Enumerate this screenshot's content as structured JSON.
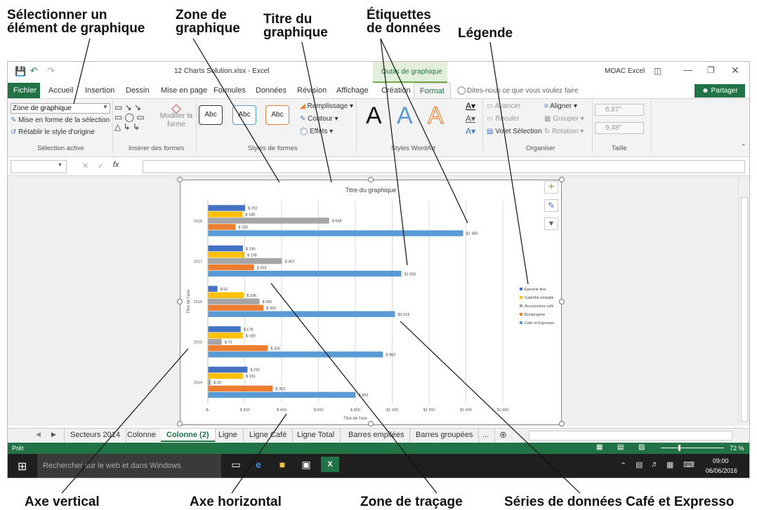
{
  "callouts": {
    "select_element": "Sélectionner un\nélément de graphique",
    "chart_area": "Zone de\ngraphique",
    "chart_title": "Titre du\ngraphique",
    "data_labels": "Étiquettes\nde données",
    "legend": "Légende",
    "vertical_axis": "Axe vertical",
    "horizontal_axis": "Axe horizontal",
    "plot_area": "Zone de traçage",
    "series": "Séries de données Café et Expresso"
  },
  "titlebar": {
    "file": "12 Charts Solution.xlsx - Excel",
    "context": "Outils de graphique",
    "account": "MOAC Excel"
  },
  "tabs": [
    "Fichier",
    "Accueil",
    "Insertion",
    "Dessin",
    "Mise en page",
    "Formules",
    "Données",
    "Révision",
    "Affichage",
    "Création",
    "Format"
  ],
  "tell_me": "Dites-nous ce que vous voulez faire",
  "share": "Partager",
  "ribbon": {
    "selection_dropdown": "Zone de graphique",
    "format_selection": "Mise en forme de la sélection",
    "reset_style": "Rétablir le style d'origine",
    "group_selection": "Sélection active",
    "modify_shape": "Modifier la forme",
    "group_shapes": "Insérer des formes",
    "shape_style_label": "Abc",
    "fill": "Remplissage",
    "outline": "Contour",
    "effects": "Effets",
    "group_shape_styles": "Styles de formes",
    "wordart_letter": "A",
    "group_wordart": "Styles WordArt",
    "bring_forward": "Avancer",
    "send_backward": "Reculer",
    "selection_pane": "Volet Sélection",
    "align": "Aligner",
    "group": "Grouper",
    "rotate": "Rotation",
    "group_arrange": "Organiser",
    "height": "6,87\"",
    "width": "9,48\"",
    "group_size": "Taille"
  },
  "formula_bar": {
    "fx": "fx"
  },
  "chart_data": {
    "type": "bar",
    "title": "Titre du graphique",
    "xlabel": "Titre de l'axe",
    "ylabel": "Titre de l'axe",
    "categories": [
      "2014",
      "2015",
      "2016",
      "2017",
      "2018"
    ],
    "xticks": [
      "$-",
      "$ 200",
      "$ 400",
      "$ 600",
      "$ 800",
      "$1 000",
      "$1 200",
      "$1 400",
      "$1 600"
    ],
    "xlim": [
      0,
      1600
    ],
    "series": [
      {
        "name": "Épicerie fine",
        "color": "#4472c4",
        "values": [
          215,
          178,
          52,
          190,
          202
        ],
        "labels": [
          "$ 215",
          "$ 178",
          "$ 52",
          "$ 190",
          "$ 202"
        ]
      },
      {
        "name": "Café/thé emballé",
        "color": "#ffc000",
        "values": [
          191,
          190,
          195,
          198,
          188
        ],
        "labels": [
          "$ 191",
          "$ 190",
          "$ 195",
          "$ 198",
          "$ 188"
        ]
      },
      {
        "name": "Accessoires café",
        "color": "#a5a5a5",
        "values": [
          15,
          75,
          280,
          402,
          658
        ],
        "labels": [
          "$ 15",
          "$ 75",
          "$ 280",
          "$ 402",
          "$ 658"
        ]
      },
      {
        "name": "Boulangerie",
        "color": "#ed7d31",
        "values": [
          352,
          325,
          302,
          250,
          150
        ],
        "labels": [
          "$ 352",
          "$ 325",
          "$ 302",
          "$ 250",
          "$ 150"
        ]
      },
      {
        "name": "Café et Expresso",
        "color": "#5b9bd5",
        "values": [
          802,
          950,
          1015,
          1050,
          1385
        ],
        "labels": [
          "$ 802",
          "$ 950",
          "$1 015",
          "$1 050",
          "$1 385"
        ]
      }
    ],
    "legend_position": "right",
    "grid": true
  },
  "sheets": [
    "Secteurs 2014",
    "Colonne",
    "Colonne (2)",
    "Ligne",
    "Ligne Café",
    "Ligne Total",
    "Barres empilées",
    "Barres groupées",
    "..."
  ],
  "status": {
    "ready": "Prêt",
    "zoom": "72 %"
  },
  "taskbar": {
    "search": "Rechercher sur le web et dans Windows",
    "time": "09:00",
    "date": "06/06/2016"
  }
}
